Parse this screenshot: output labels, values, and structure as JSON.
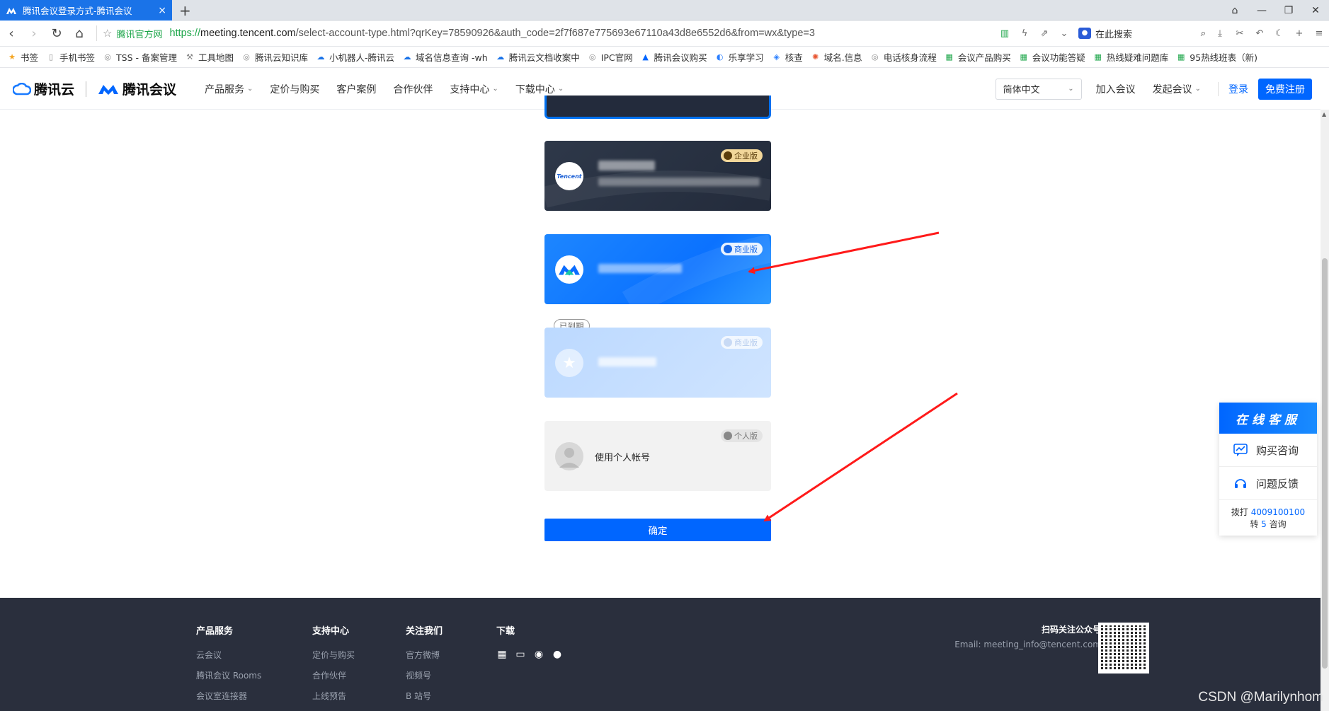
{
  "browser": {
    "tab_title": "腾讯会议登录方式-腾讯会议",
    "tab_close": "×",
    "new_tab": "+",
    "site_tag": "腾讯官方网",
    "url_scheme": "https://",
    "url_host": "meeting.tencent.com",
    "url_path": "/select-account-type.html?qrKey=78590926&auth_code=2f7f687e775693e67110a43d8e6552d6&from=wx&type=3",
    "search_placeholder": "在此搜索"
  },
  "bookmarks": [
    {
      "label": "书签",
      "icon": "star-icon",
      "color": "#f5a623"
    },
    {
      "label": "手机书签",
      "icon": "phone-icon",
      "color": "#888888"
    },
    {
      "label": "TSS - 备案管理",
      "icon": "globe-icon",
      "color": "#888888"
    },
    {
      "label": "工具地图",
      "icon": "tool-icon",
      "color": "#888888"
    },
    {
      "label": "腾讯云知识库",
      "icon": "globe-icon",
      "color": "#888888"
    },
    {
      "label": "小机器人-腾讯云",
      "icon": "cloud-icon",
      "color": "#1a73e8"
    },
    {
      "label": "域名信息查询 -wh",
      "icon": "cloud-icon",
      "color": "#1a73e8"
    },
    {
      "label": "腾讯云文档收案中",
      "icon": "cloud-icon",
      "color": "#1a73e8"
    },
    {
      "label": "IPC官网",
      "icon": "globe-icon",
      "color": "#888888"
    },
    {
      "label": "腾讯会议购买",
      "icon": "meeting-icon",
      "color": "#0066ff"
    },
    {
      "label": "乐享学习",
      "icon": "lexiang-icon",
      "color": "#2a7fff"
    },
    {
      "label": "核查",
      "icon": "shield-icon",
      "color": "#2a7fff"
    },
    {
      "label": "域名.信息",
      "icon": "gear-icon",
      "color": "#e8542f"
    },
    {
      "label": "电话核身流程",
      "icon": "globe-icon",
      "color": "#888888"
    },
    {
      "label": "会议产品购买",
      "icon": "sheet-icon",
      "color": "#1ba548"
    },
    {
      "label": "会议功能答疑",
      "icon": "sheet-icon",
      "color": "#1ba548"
    },
    {
      "label": "热线疑难问题库",
      "icon": "sheet-icon",
      "color": "#1ba548"
    },
    {
      "label": "95热线班表（新)",
      "icon": "sheet-icon",
      "color": "#1ba548"
    }
  ],
  "header": {
    "brand_cloud": "腾讯云",
    "brand_meeting": "腾讯会议",
    "nav": [
      {
        "label": "产品服务",
        "dropdown": true
      },
      {
        "label": "定价与购买",
        "dropdown": false
      },
      {
        "label": "客户案例",
        "dropdown": false
      },
      {
        "label": "合作伙伴",
        "dropdown": false
      },
      {
        "label": "支持中心",
        "dropdown": true
      },
      {
        "label": "下载中心",
        "dropdown": true
      }
    ],
    "language": "简体中文",
    "join_meeting": "加入会议",
    "start_meeting": "发起会议",
    "login": "登录",
    "register": "免费注册"
  },
  "accounts": {
    "enterprise_badge": "企业版",
    "enterprise_avatar_text": "Tencent",
    "business_badge": "商业版",
    "expired_tag": "已到期",
    "expired_badge": "商业版",
    "personal_badge": "个人版",
    "personal_label": "使用个人帐号",
    "confirm": "确定"
  },
  "service": {
    "title": "在线客服",
    "purchase": "购买咨询",
    "feedback": "问题反馈",
    "call_prefix": "拨打",
    "phone": "4009100100",
    "turn_prefix": "转",
    "ext": "5",
    "turn_suffix": "咨询"
  },
  "footer": {
    "cols": [
      {
        "heading": "产品服务",
        "links": [
          "云会议",
          "腾讯会议 Rooms",
          "会议室连接器"
        ]
      },
      {
        "heading": "支持中心",
        "links": [
          "定价与购买",
          "合作伙伴",
          "上线预告"
        ]
      },
      {
        "heading": "关注我们",
        "links": [
          "官方微博",
          "视频号",
          "B 站号"
        ]
      }
    ],
    "download_heading": "下载",
    "qr_title": "扫码关注公众号",
    "email": "Email: meeting_info@tencent.com"
  },
  "watermark": "CSDN @Marilynhom",
  "colors": {
    "accent": "#0066ff",
    "annotation_arrow": "#ff1a1a",
    "footer_bg": "#2a2f3d"
  }
}
